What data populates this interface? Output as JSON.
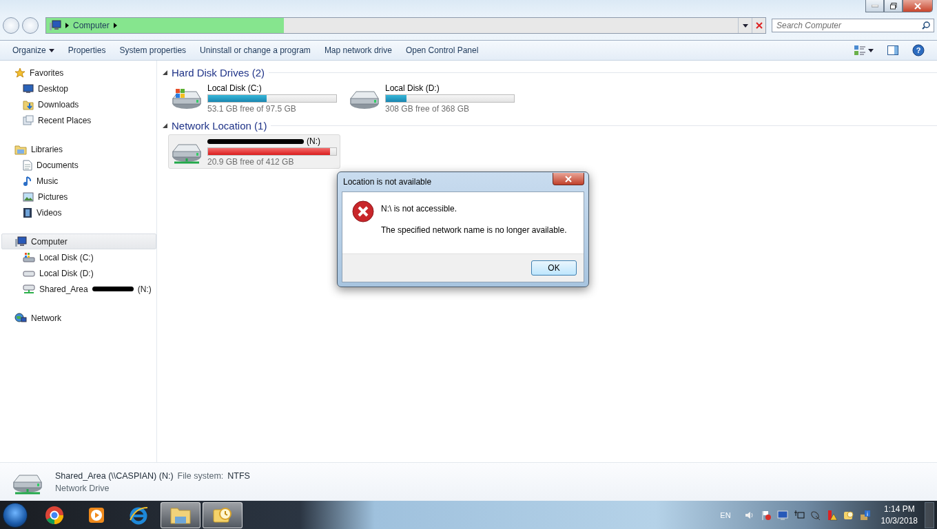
{
  "address_bar": {
    "path": [
      "Computer"
    ],
    "level": 0.33
  },
  "search": {
    "placeholder": "Search Computer"
  },
  "toolbar": {
    "items": [
      {
        "label": "Organize",
        "dropdown": true
      },
      {
        "label": "Properties",
        "dropdown": false
      },
      {
        "label": "System properties",
        "dropdown": false
      },
      {
        "label": "Uninstall or change a program",
        "dropdown": false
      },
      {
        "label": "Map network drive",
        "dropdown": false
      },
      {
        "label": "Open Control Panel",
        "dropdown": false
      }
    ],
    "help": "?"
  },
  "sidebar": {
    "groups": [
      {
        "label": "Favorites",
        "kind": "star",
        "selected": false,
        "children": [
          {
            "label": "Desktop",
            "kind": "desktop",
            "selected": false
          },
          {
            "label": "Downloads",
            "kind": "downloads",
            "selected": false
          },
          {
            "label": "Recent Places",
            "kind": "recent",
            "selected": false
          }
        ]
      },
      {
        "label": "Libraries",
        "kind": "libraries",
        "selected": false,
        "children": [
          {
            "label": "Documents",
            "kind": "document",
            "selected": false
          },
          {
            "label": "Music",
            "kind": "music",
            "selected": false
          },
          {
            "label": "Pictures",
            "kind": "picture",
            "selected": false
          },
          {
            "label": "Videos",
            "kind": "video",
            "selected": false
          }
        ]
      },
      {
        "label": "Computer",
        "kind": "computer",
        "selected": true,
        "children": [
          {
            "label": "Local Disk (C:)",
            "kind": "system-drive",
            "selected": false,
            "redacted": false
          },
          {
            "label": "Local Disk (D:)",
            "kind": "drive",
            "selected": false,
            "redacted": false
          },
          {
            "label": "Shared_Area",
            "suffix": "(N:)",
            "kind": "network-drive",
            "selected": false,
            "redacted": true
          }
        ]
      },
      {
        "label": "Network",
        "kind": "network",
        "selected": false
      }
    ]
  },
  "content": {
    "sections": [
      {
        "title": "Hard Disk Drives (2)",
        "expanded": true,
        "drives": [
          {
            "name": "Local Disk (C:)",
            "kind": "system-drive",
            "level": 0.455,
            "free": "53.1 GB free of 97.5 GB",
            "low_space": false,
            "selected": false,
            "redacted": false
          },
          {
            "name": "Local Disk (D:)",
            "kind": "drive",
            "level": 0.163,
            "free": "308 GB free of 368 GB",
            "low_space": false,
            "selected": false,
            "redacted": false
          }
        ]
      },
      {
        "title": "Network Location (1)",
        "expanded": true,
        "drives": [
          {
            "name": "(N:)",
            "kind": "network-drive",
            "level": 0.95,
            "free": "20.9 GB free of 412 GB",
            "low_space": true,
            "selected": true,
            "redacted": true
          }
        ]
      }
    ]
  },
  "dialog": {
    "title": "Location is not available",
    "message": "N:\\ is not accessible.",
    "detail": "The specified network name is no longer available.",
    "button": "OK"
  },
  "details_pane": {
    "name": "Shared_Area (\\\\CASPIAN) (N:)",
    "fs_label": "File system:",
    "fs_value": "NTFS",
    "type": "Network Drive"
  },
  "taskbar": {
    "apps": [
      {
        "kind": "chrome",
        "active": false
      },
      {
        "kind": "media",
        "active": false
      },
      {
        "kind": "ie",
        "active": false
      },
      {
        "kind": "explorer",
        "active": true
      },
      {
        "kind": "outlook",
        "active": true
      }
    ],
    "tray": {
      "language": "EN",
      "icons": [
        {
          "kind": "volume"
        },
        {
          "kind": "flag"
        },
        {
          "kind": "display"
        },
        {
          "kind": "network"
        },
        {
          "kind": "satellite"
        },
        {
          "kind": "antivirus"
        },
        {
          "kind": "outlook"
        },
        {
          "kind": "info"
        }
      ],
      "time": "1:14 PM",
      "date": "10/3/2018"
    }
  }
}
